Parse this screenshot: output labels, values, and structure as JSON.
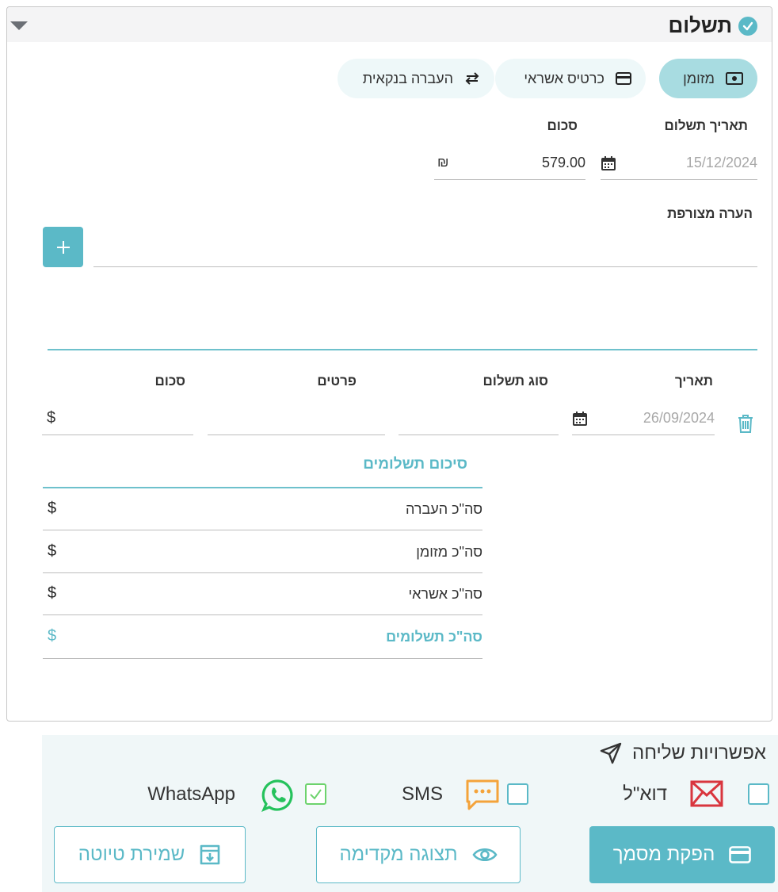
{
  "section": {
    "title": "תשלום"
  },
  "payment_methods": [
    {
      "label": "מזומן",
      "icon": "cash-icon",
      "active": true
    },
    {
      "label": "כרטיס אשראי",
      "icon": "credit-card-icon",
      "active": false
    },
    {
      "label": "העברה בנקאית",
      "icon": "transfer-arrows-icon",
      "active": false
    }
  ],
  "form": {
    "payment_date_label": "תאריך תשלום",
    "payment_date_value": "15/12/2024",
    "amount_label": "סכום",
    "amount_value": "579.00",
    "amount_currency": "₪",
    "note_label": "הערה מצורפת",
    "note_value": ""
  },
  "payment_row": {
    "columns": {
      "date": "תאריך",
      "payment_type": "סוג תשלום",
      "details": "פרטים",
      "amount": "סכום"
    },
    "date_value": "26/09/2024",
    "currency": "$"
  },
  "summary": {
    "title": "סיכום תשלומים",
    "rows": [
      {
        "label": "סה\"כ העברה",
        "currency": "$"
      },
      {
        "label": "סה\"כ מזומן",
        "currency": "$"
      },
      {
        "label": "סה\"כ אשראי",
        "currency": "$"
      },
      {
        "label": "סה\"כ תשלומים",
        "currency": "$"
      }
    ]
  },
  "send_options": {
    "title": "אפשרויות שליחה",
    "email": {
      "label": "דוא\"ל",
      "checked": false
    },
    "sms": {
      "label": "SMS",
      "checked": false
    },
    "whatsapp": {
      "label": "WhatsApp",
      "checked": true
    }
  },
  "actions": {
    "issue": "הפקת מסמך",
    "preview": "תצוגה מקדימה",
    "save_draft": "שמירת טיוטה"
  },
  "colors": {
    "accent": "#5bb9c7",
    "active_pill": "#a8dce1",
    "email_red": "#d9363e",
    "sms_orange": "#f4a33a",
    "whatsapp_green": "#25c25c"
  }
}
